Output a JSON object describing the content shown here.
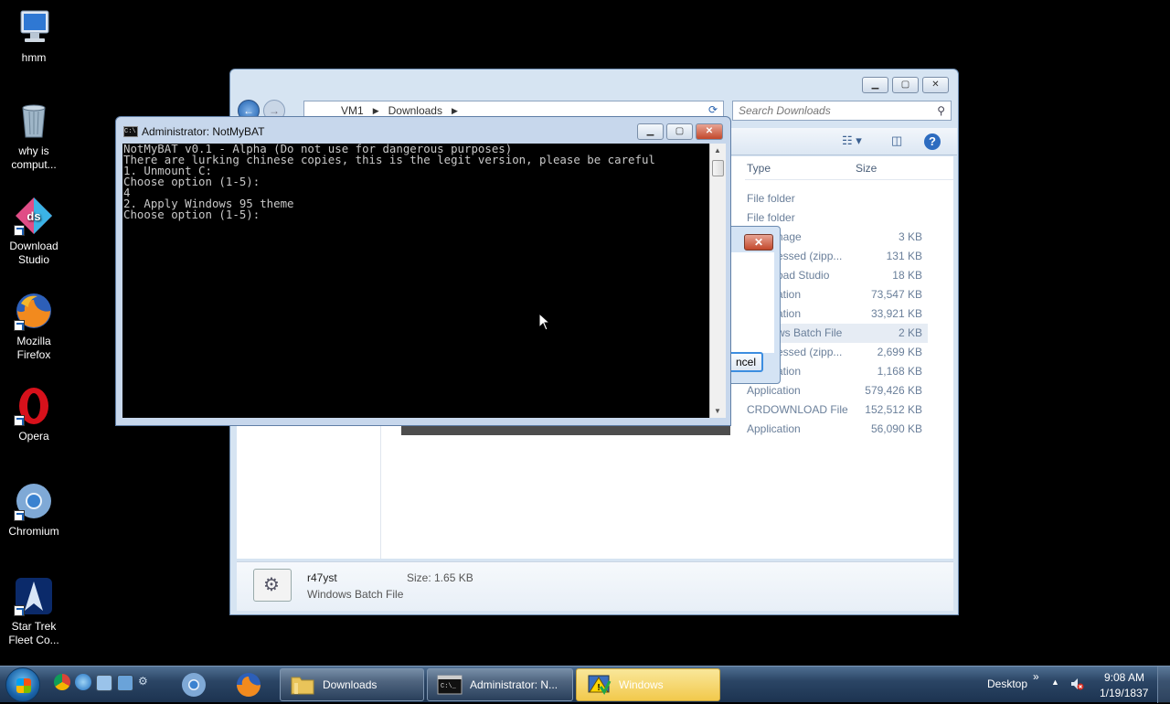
{
  "desktop": {
    "icons": [
      {
        "label": "hmm",
        "icon": "monitor-icon"
      },
      {
        "label": "why is comput...",
        "icon": "recycle-bin-icon"
      },
      {
        "label": "Download Studio",
        "icon": "download-studio-icon"
      },
      {
        "label": "Mozilla Firefox",
        "icon": "firefox-icon"
      },
      {
        "label": "Opera",
        "icon": "opera-icon"
      },
      {
        "label": "Chromium",
        "icon": "chromium-icon"
      },
      {
        "label": "Star Trek Fleet Co...",
        "icon": "star-trek-icon"
      }
    ]
  },
  "explorer": {
    "breadcrumb": [
      "VM1",
      "Downloads"
    ],
    "search_placeholder": "Search Downloads",
    "columns": {
      "type": "Type",
      "size": "Size"
    },
    "rows": [
      {
        "type": "File folder",
        "size": ""
      },
      {
        "type": "File folder",
        "size": ""
      },
      {
        "type": "nage",
        "size": "3 KB"
      },
      {
        "type": "essed (zipp...",
        "size": "131 KB"
      },
      {
        "type": "oad Studio",
        "size": "18 KB"
      },
      {
        "type": "ation",
        "size": "73,547 KB"
      },
      {
        "type": "ation",
        "size": "33,921 KB"
      },
      {
        "type": "ws Batch File",
        "size": "2 KB"
      },
      {
        "type": "essed (zipp...",
        "size": "2,699 KB"
      },
      {
        "type": "ation",
        "size": "1,168 KB"
      },
      {
        "type": "Application",
        "size": "579,426 KB"
      },
      {
        "type": "CRDOWNLOAD File",
        "size": "152,512 KB"
      },
      {
        "type": "Application",
        "size": "56,090 KB"
      }
    ],
    "details": {
      "name": "r47yst",
      "kind": "Windows Batch File",
      "size": "Size: 1.65 KB"
    }
  },
  "dialog": {
    "cancel_label": "ncel"
  },
  "console": {
    "title": "Administrator:  NotMyBAT",
    "lines": [
      "NotMyBAT v0.1 - Alpha (Do not use for dangerous purposes)",
      "There are lurking chinese copies, this is the legit version, please be careful",
      "1. Unmount C:",
      "Choose option (1-5):",
      "4",
      "2. Apply Windows 95 theme",
      "Choose option (1-5):"
    ]
  },
  "taskbar": {
    "buttons": [
      {
        "label": "Downloads",
        "icon": "folder-icon"
      },
      {
        "label": "Administrator:  N...",
        "icon": "cmd-icon"
      },
      {
        "label": "Windows",
        "icon": "warning-icon"
      }
    ],
    "desktop_label": "Desktop",
    "time": "9:08 AM",
    "date": "1/19/1837"
  },
  "colors": {
    "accent_yellow": "#f5d76e",
    "console_bg": "#000000",
    "console_text": "#c8c8c8"
  }
}
